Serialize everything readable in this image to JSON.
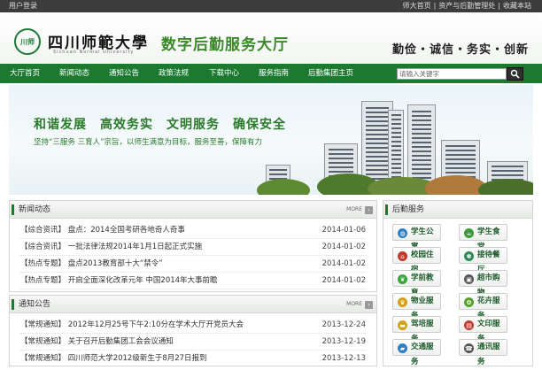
{
  "topbar": {
    "login": "用户登录",
    "links": [
      "师大首页",
      "|",
      "资产与后勤管理处",
      "|",
      "收藏本站"
    ]
  },
  "header": {
    "emblem_text": "川师",
    "university": "四川师範大學",
    "university_en": "Sichuan Normal University",
    "hall": "数字后勤服务大厅",
    "motto": "勤俭・诚信・务实・创新"
  },
  "nav": {
    "items": [
      "大厅首页",
      "新闻动态",
      "通知公告",
      "政策法规",
      "下载中心",
      "服务指南",
      "后勤集团主页"
    ]
  },
  "search": {
    "placeholder": "请输入关键字",
    "icon": "search-icon"
  },
  "banner": {
    "slogan": "和谐发展　高效务实　文明服务　确保安全",
    "sub": "坚持“三服务 三育人”宗旨，以师生满意为目标，服务至善，保障有力"
  },
  "news": {
    "title": "新闻动态",
    "more": "MORE",
    "rows": [
      {
        "text": "【综合资讯】 盘点：2014全国考研各地奇人奇事",
        "date": "2014-01-06"
      },
      {
        "text": "【综合资讯】 一批法律法规2014年1月1日起正式实施",
        "date": "2014-01-02"
      },
      {
        "text": "【热点专题】 盘点2013教育部十大“禁令”",
        "date": "2014-01-02"
      },
      {
        "text": "【热点专题】 开启全面深化改革元年 中国2014年大事前瞻",
        "date": "2014-01-02"
      }
    ]
  },
  "notice": {
    "title": "通知公告",
    "more": "MORE",
    "rows": [
      {
        "text": "【常规通知】 2012年12月25号下午2:10分在学术大厅开党员大会",
        "date": "2013-12-24"
      },
      {
        "text": "【常规通知】 关于召开后勤集团工会会议通知",
        "date": "2013-12-19"
      },
      {
        "text": "【常规通知】 四川师范大学2012级新生于8月27日报到",
        "date": "2013-12-13"
      }
    ]
  },
  "services": {
    "title": "后勤服务",
    "items": [
      {
        "label": "学生公寓",
        "icon": "globe-icon",
        "color": "#2f7fc0"
      },
      {
        "label": "学生食堂",
        "icon": "food-icon",
        "color": "#3a9a3a"
      },
      {
        "label": "校园住宿",
        "icon": "house-icon",
        "color": "#c0392b"
      },
      {
        "label": "接待餐厅",
        "icon": "hospitality-icon",
        "color": "#2e8b57"
      },
      {
        "label": "学前教育",
        "icon": "leaf-icon",
        "color": "#3aa63a"
      },
      {
        "label": "超市购物",
        "icon": "cart-icon",
        "color": "#555555"
      },
      {
        "label": "物业服务",
        "icon": "trophy-icon",
        "color": "#d4a017"
      },
      {
        "label": "花卉服务",
        "icon": "flower-icon",
        "color": "#5aa02c"
      },
      {
        "label": "驾培服务",
        "icon": "car-icon",
        "color": "#d4a017"
      },
      {
        "label": "文印服务",
        "icon": "print-icon",
        "color": "#c0392b"
      },
      {
        "label": "交通服务",
        "icon": "bus-icon",
        "color": "#2f7fc0"
      },
      {
        "label": "通讯服务",
        "icon": "phone-icon",
        "color": "#555555"
      }
    ]
  },
  "colors": {
    "brand_green": "#1b7a30",
    "topbar": "#3c3c3c"
  }
}
